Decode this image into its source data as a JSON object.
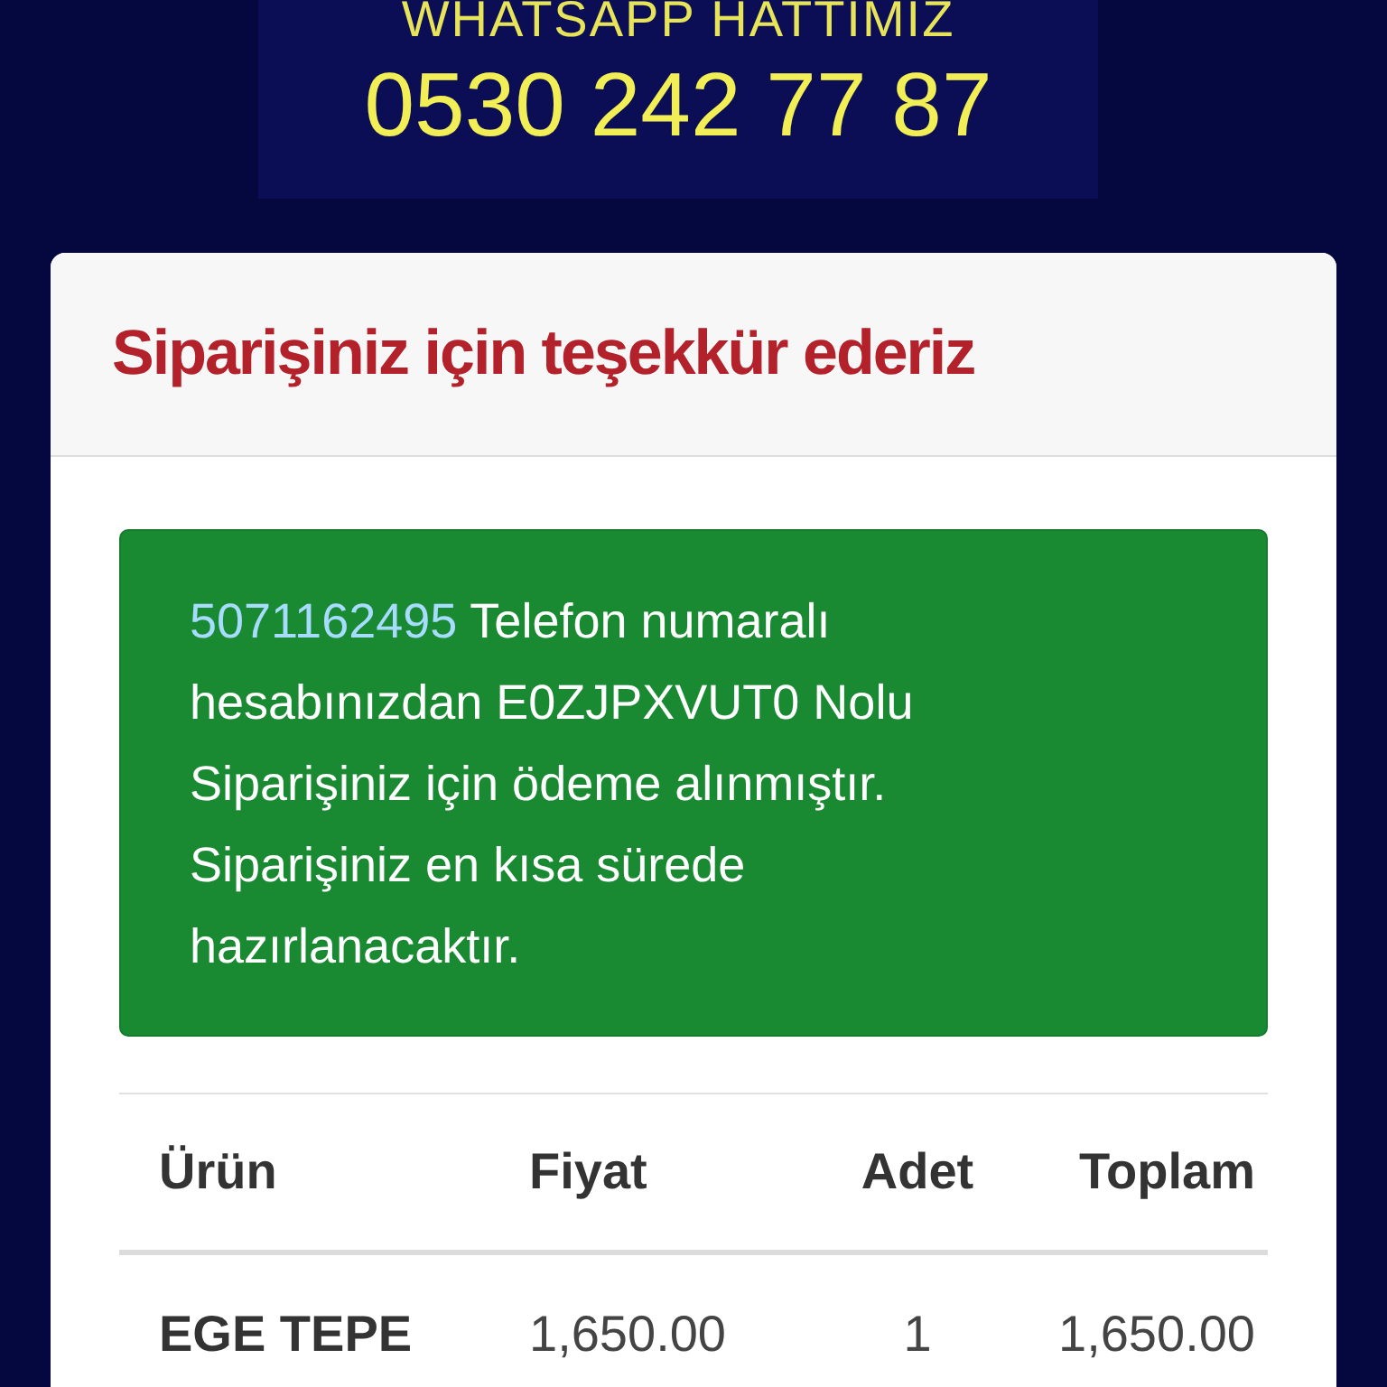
{
  "banner": {
    "title": "WHATSAPP HATTIMIZ",
    "phone": "0530 242 77 87"
  },
  "card": {
    "title": "Siparişiniz için teşekkür ederiz",
    "alert": {
      "phone_link": "5071162495",
      "message": "Telefon numaralı hesabınızdan E0ZJPXVUT0 Nolu Siparişiniz için ödeme alınmıştır. Siparişiniz en kısa sürede hazırlanacaktır."
    },
    "table": {
      "columns": [
        "Ürün",
        "Fiyat",
        "Adet",
        "Toplam"
      ],
      "rows": [
        [
          "EGE TEPE",
          "1,650.00",
          "1",
          "1,650.00"
        ]
      ]
    }
  }
}
